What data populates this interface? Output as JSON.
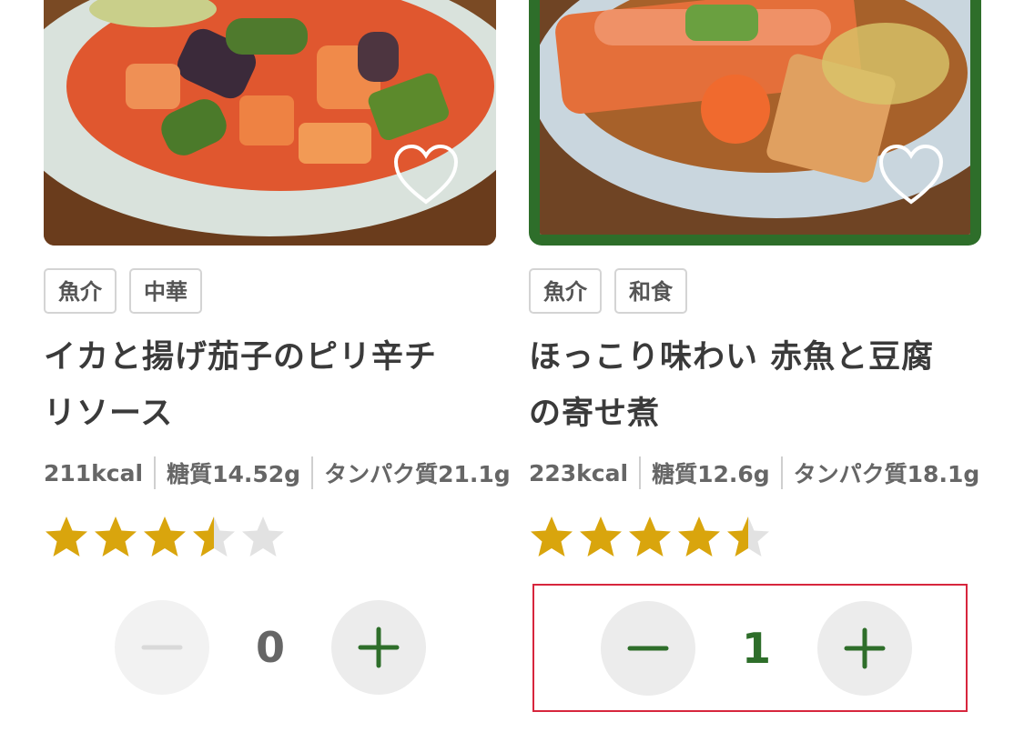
{
  "colors": {
    "accent_green": "#2e6e2a",
    "star_gold": "#d9a50d",
    "star_empty": "#e2e2e2",
    "highlight_frame": "#d7263d"
  },
  "recipes": [
    {
      "tags": [
        "魚介",
        "中華"
      ],
      "title_lines": [
        "イカと揚げ茄子のピリ辛チ",
        "リソース"
      ],
      "calories": "211kcal",
      "carbs": "糖質14.52g",
      "protein": "タンパク質21.1g",
      "rating": 3.5,
      "favorite_icon": "heart-outline-icon",
      "quantity": "0",
      "selected": false
    },
    {
      "tags": [
        "魚介",
        "和食"
      ],
      "title_lines": [
        "ほっこり味わい 赤魚と豆腐",
        "の寄せ煮"
      ],
      "calories": "223kcal",
      "carbs": "糖質12.6g",
      "protein": "タンパク質18.1g",
      "rating": 4.5,
      "favorite_icon": "heart-outline-icon",
      "quantity": "1",
      "selected": true
    }
  ]
}
